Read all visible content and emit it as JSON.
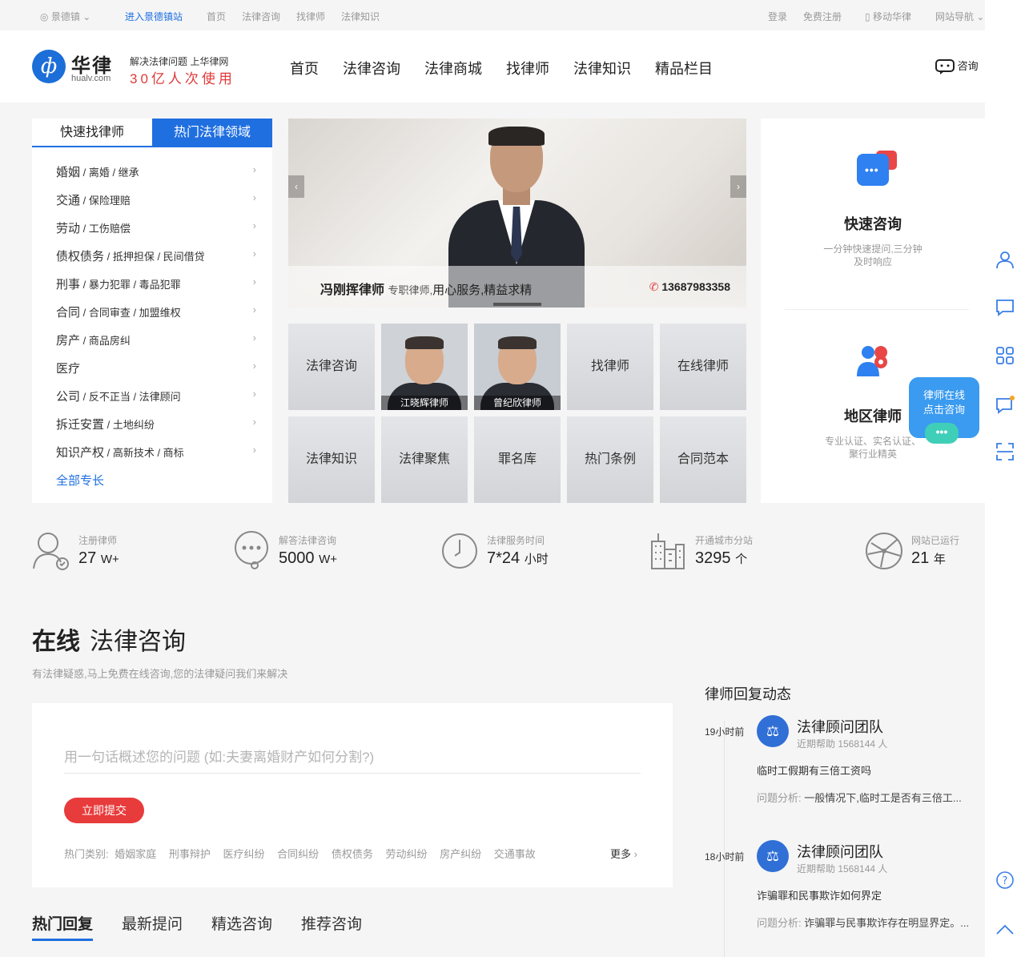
{
  "topbar": {
    "city": "景德镇",
    "station": "进入景德镇站",
    "links": [
      "首页",
      "法律咨询",
      "找律师",
      "法律知识"
    ],
    "right": [
      "登录",
      "免费注册",
      "移动华律",
      "网站导航"
    ]
  },
  "header": {
    "logo_mark": "ф",
    "logo_cn": "华律",
    "logo_en": "hualv.com",
    "slogan_top": "解决法律问题 上华律网",
    "slogan_bottom": "30亿人次使用",
    "nav": [
      "首页",
      "法律咨询",
      "法律商城",
      "找律师",
      "法律知识",
      "精品栏目"
    ],
    "consult": "咨询"
  },
  "categories": {
    "tabs": [
      "快速找律师",
      "热门法律领域"
    ],
    "items": [
      {
        "main": "婚姻",
        "sub": " / 离婚 / 继承"
      },
      {
        "main": "交通",
        "sub": " / 保险理赔"
      },
      {
        "main": "劳动",
        "sub": " / 工伤赔偿"
      },
      {
        "main": "债权债务",
        "sub": " / 抵押担保 / 民间借贷"
      },
      {
        "main": "刑事",
        "sub": " / 暴力犯罪 / 毒品犯罪"
      },
      {
        "main": "合同",
        "sub": " / 合同审查 / 加盟维权"
      },
      {
        "main": "房产",
        "sub": " / 商品房纠"
      },
      {
        "main": "医疗",
        "sub": ""
      },
      {
        "main": "公司",
        "sub": " / 反不正当 / 法律顾问"
      },
      {
        "main": "拆迁安置",
        "sub": " / 土地纠纷"
      },
      {
        "main": "知识产权",
        "sub": " / 高新技术 / 商标"
      }
    ],
    "more": "全部专长"
  },
  "banner": {
    "name": "冯刚挥律师",
    "title": "专职律师,",
    "motto": "用心服务,精益求精",
    "phone": "13687983358"
  },
  "tiles": {
    "t1": "法律咨询",
    "lawyer1": "江晓辉律师",
    "lawyer2": "曾纪欣律师",
    "t4": "找律师",
    "t5": "在线律师",
    "t6": "法律知识",
    "t7": "法律聚焦",
    "t8": "罪名库",
    "t9": "热门条例",
    "t10": "合同范本"
  },
  "rpanel": {
    "quick_title": "快速咨询",
    "quick_sub1": "一分钟快速提问,三分钟",
    "quick_sub2": "及时响应",
    "area_title": "地区律师",
    "area_sub1": "专业认证、实名认证、",
    "area_sub2": "聚行业精英",
    "float_line1": "律师在线",
    "float_line2": "点击咨询"
  },
  "stats": [
    {
      "label": "注册律师",
      "value": "27",
      "unit": "W+"
    },
    {
      "label": "解答法律咨询",
      "value": "5000",
      "unit": "W+"
    },
    {
      "label": "法律服务时间",
      "value": "7*24",
      "unit": "小时"
    },
    {
      "label": "开通城市分站",
      "value": "3295",
      "unit": "个"
    },
    {
      "label": "网站已运行",
      "value": "21",
      "unit": "年"
    }
  ],
  "section": {
    "title_bold": "在线",
    "title": "法律咨询",
    "subtitle": "有法律疑惑,马上免费在线咨询,您的法律疑问我们来解决",
    "placeholder": "用一句话概述您的问题 (如:夫妻离婚财产如何分割?)",
    "submit": "立即提交",
    "hot_label": "热门类别:",
    "hot": [
      "婚姻家庭",
      "刑事辩护",
      "医疗纠纷",
      "合同纠纷",
      "债权债务",
      "劳动纠纷",
      "房产纠纷",
      "交通事故"
    ],
    "more": "更多",
    "tabs": [
      "热门回复",
      "最新提问",
      "精选咨询",
      "推荐咨询"
    ]
  },
  "replies": {
    "title": "律师回复动态",
    "items": [
      {
        "time": "19小时前",
        "name": "法律顾问团队",
        "help": "近期帮助 1568144 人",
        "q": "临时工假期有三倍工资吗",
        "a_label": "问题分析:",
        "a": "一般情况下,临时工是否有三倍工..."
      },
      {
        "time": "18小时前",
        "name": "法律顾问团队",
        "help": "近期帮助 1568144 人",
        "q": "诈骗罪和民事欺诈如何界定",
        "a_label": "问题分析:",
        "a": "诈骗罪与民事欺诈存在明显界定。..."
      }
    ]
  },
  "colors": {
    "accent": "#1f6fe0",
    "red": "#e83b3b"
  }
}
